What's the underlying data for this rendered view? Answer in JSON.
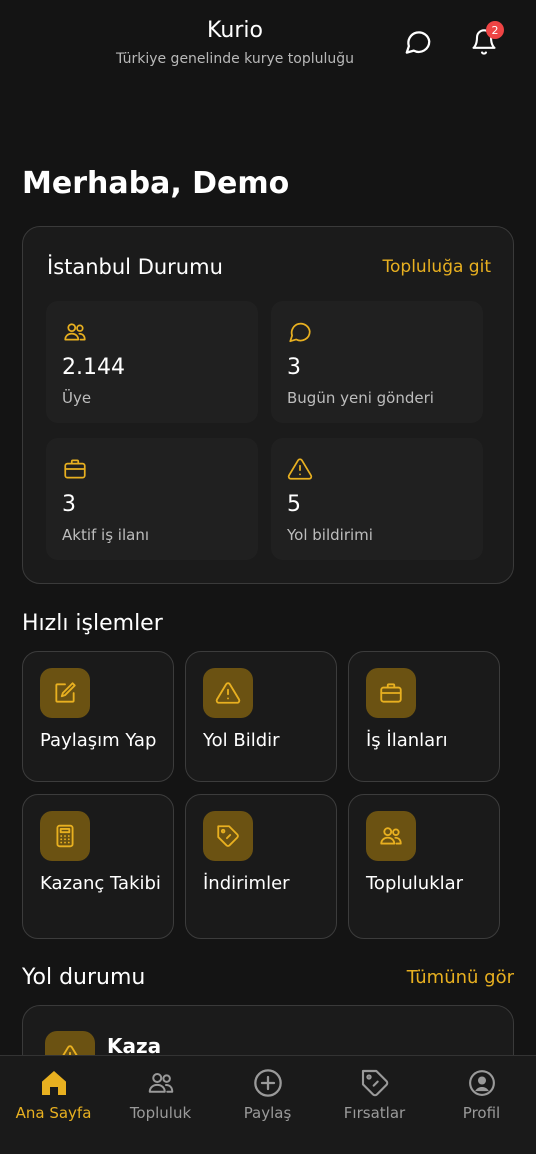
{
  "header": {
    "title": "Kurio",
    "subtitle": "Türkiye genelinde kurye topluluğu",
    "notification_count": "2"
  },
  "greeting": "Merhaba, Demo",
  "city_status": {
    "title": "İstanbul Durumu",
    "link": "Topluluğa git",
    "stats": [
      {
        "value": "2.144",
        "label": "Üye",
        "icon": "users-icon"
      },
      {
        "value": "3",
        "label": "Bugün yeni gönderi",
        "icon": "chat-icon"
      },
      {
        "value": "3",
        "label": "Aktif iş ilanı",
        "icon": "briefcase-icon"
      },
      {
        "value": "5",
        "label": "Yol bildirimi",
        "icon": "warning-icon"
      }
    ]
  },
  "quick_actions": {
    "title": "Hızlı işlemler",
    "items": [
      {
        "label": "Paylaşım Yap",
        "icon": "edit-icon"
      },
      {
        "label": "Yol Bildir",
        "icon": "warning-icon"
      },
      {
        "label": "İş İlanları",
        "icon": "briefcase-icon"
      },
      {
        "label": "Kazanç Takibi",
        "icon": "calculator-icon"
      },
      {
        "label": "İndirimler",
        "icon": "tag-icon"
      },
      {
        "label": "Topluluklar",
        "icon": "users-icon"
      }
    ]
  },
  "road_status": {
    "title": "Yol durumu",
    "link": "Tümünü gör",
    "first_item_title": "Kaza"
  },
  "bottom_nav": [
    {
      "label": "Ana Sayfa",
      "icon": "home-icon",
      "active": true
    },
    {
      "label": "Topluluk",
      "icon": "users-icon"
    },
    {
      "label": "Paylaş",
      "icon": "plus-circle-icon"
    },
    {
      "label": "Fırsatlar",
      "icon": "tag-icon"
    },
    {
      "label": "Profil",
      "icon": "profile-icon"
    }
  ],
  "colors": {
    "accent": "#e8b020",
    "background": "#141414",
    "card": "#1b1b1b",
    "badge": "#ef4444"
  }
}
